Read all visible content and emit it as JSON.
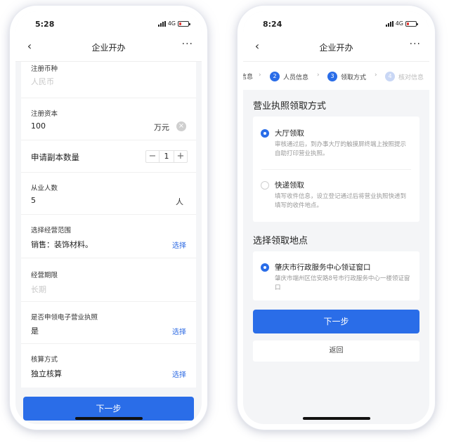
{
  "left": {
    "status": {
      "time": "5:28",
      "network": "4G"
    },
    "nav": {
      "title": "企业开办",
      "more": "···"
    },
    "form": {
      "currency": {
        "label": "注册币种",
        "placeholder": "人民币"
      },
      "capital": {
        "label": "注册资本",
        "value": "100",
        "unit": "万元"
      },
      "copies": {
        "label": "申请副本数量",
        "value": "1",
        "minus": "−",
        "plus": "+"
      },
      "employees": {
        "label": "从业人数",
        "value": "5",
        "unit": "人"
      },
      "scope": {
        "label": "选择经营范围",
        "value": "销售：装饰材料。",
        "action": "选择"
      },
      "period": {
        "label": "经营期限",
        "placeholder": "长期"
      },
      "elicense": {
        "label": "是否申领电子营业执照",
        "value": "是",
        "action": "选择"
      },
      "accounting": {
        "label": "核算方式",
        "value": "独立核算",
        "action": "选择"
      }
    },
    "next_button": "下一步"
  },
  "right": {
    "status": {
      "time": "8:24",
      "network": "4G"
    },
    "nav": {
      "title": "企业开办",
      "more": "···"
    },
    "steps": {
      "prev_label": "信息",
      "step2": {
        "num": "2",
        "label": "人员信息"
      },
      "step3": {
        "num": "3",
        "label": "领取方式"
      },
      "step4": {
        "num": "4",
        "label": "核对信息"
      }
    },
    "license_section": {
      "title": "营业执照领取方式",
      "options": [
        {
          "title": "大厅领取",
          "desc": "审核通过后，到办事大厅的触摸屏终端上按照提示自助打印营业执照。",
          "selected": true
        },
        {
          "title": "快递领取",
          "desc": "填写收件信息，设立登记通过后将营业执照快递到填写的收件地点。",
          "selected": false
        }
      ]
    },
    "location_section": {
      "title": "选择领取地点",
      "options": [
        {
          "title": "肇庆市行政服务中心领证窗口",
          "desc": "肇庆市端州区信安路8号市行政服务中心一楼领证窗口",
          "selected": true
        }
      ]
    },
    "next_button": "下一步",
    "back_button": "返回"
  },
  "colors": {
    "accent": "#2a6de8",
    "battery_low": "#e53935"
  }
}
